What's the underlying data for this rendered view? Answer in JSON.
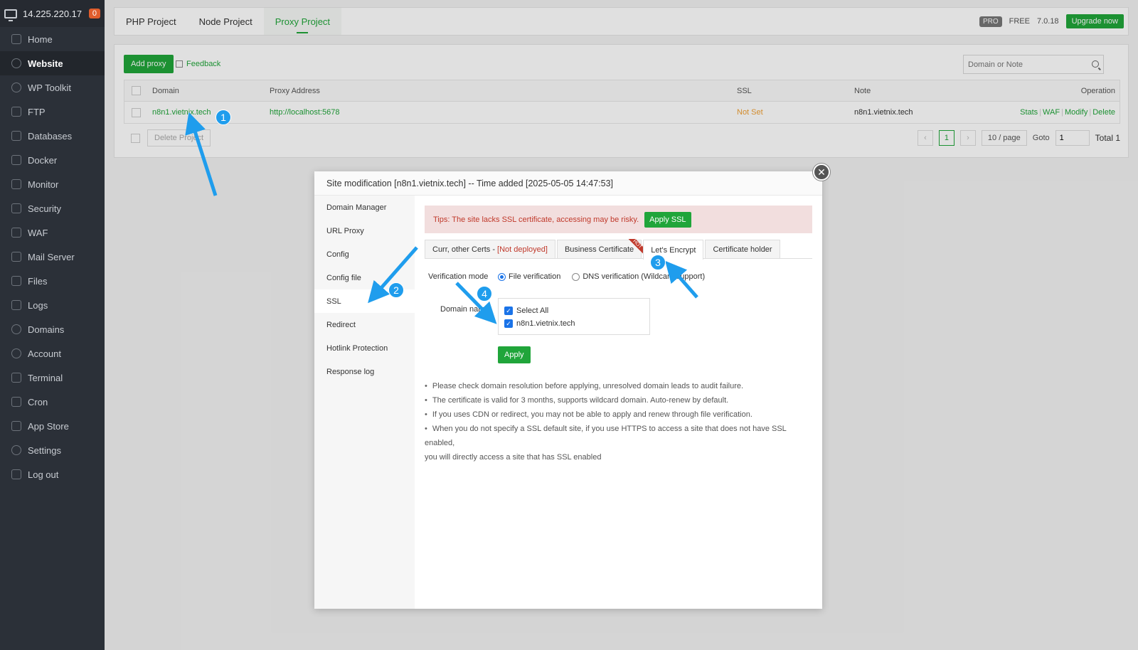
{
  "sidebar": {
    "ip": "14.225.220.17",
    "badge": "0",
    "items": [
      {
        "label": "Home",
        "icon": "home-icon"
      },
      {
        "label": "Website",
        "icon": "globe-icon"
      },
      {
        "label": "WP Toolkit",
        "icon": "wordpress-icon"
      },
      {
        "label": "FTP",
        "icon": "ftp-icon"
      },
      {
        "label": "Databases",
        "icon": "database-icon"
      },
      {
        "label": "Docker",
        "icon": "docker-icon"
      },
      {
        "label": "Monitor",
        "icon": "monitor-icon"
      },
      {
        "label": "Security",
        "icon": "shield-icon"
      },
      {
        "label": "WAF",
        "icon": "waf-icon"
      },
      {
        "label": "Mail Server",
        "icon": "mail-icon"
      },
      {
        "label": "Files",
        "icon": "folder-icon"
      },
      {
        "label": "Logs",
        "icon": "logs-icon"
      },
      {
        "label": "Domains",
        "icon": "domains-icon"
      },
      {
        "label": "Account",
        "icon": "user-icon"
      },
      {
        "label": "Terminal",
        "icon": "terminal-icon"
      },
      {
        "label": "Cron",
        "icon": "cron-icon"
      },
      {
        "label": "App Store",
        "icon": "apps-icon"
      },
      {
        "label": "Settings",
        "icon": "gear-icon"
      },
      {
        "label": "Log out",
        "icon": "logout-icon"
      }
    ]
  },
  "topbar": {
    "tabs": [
      "PHP Project",
      "Node Project",
      "Proxy Project"
    ],
    "pro": "PRO",
    "free": "FREE",
    "version": "7.0.18",
    "upgrade": "Upgrade now"
  },
  "panel": {
    "add_proxy": "Add proxy",
    "feedback": "Feedback",
    "search_placeholder": "Domain or Note",
    "columns": [
      "Domain",
      "Proxy Address",
      "SSL",
      "Note",
      "Operation"
    ],
    "row": {
      "domain": "n8n1.vietnix.tech",
      "proxy": "http://localhost:5678",
      "ssl": "Not Set",
      "note": "n8n1.vietnix.tech",
      "ops": [
        "Stats",
        "WAF",
        "Modify",
        "Delete"
      ]
    },
    "delete_project": "Delete Project",
    "page": "1",
    "page_size": "10 / page",
    "goto": "Goto",
    "goto_value": "1",
    "total": "Total 1"
  },
  "modal": {
    "title": "Site modification [n8n1.vietnix.tech] -- Time added [2025-05-05 14:47:53]",
    "nav": [
      "Domain Manager",
      "URL Proxy",
      "Config",
      "Config file",
      "SSL",
      "Redirect",
      "Hotlink Protection",
      "Response log"
    ],
    "tips": "Tips: The site lacks SSL certificate, accessing may be risky.",
    "apply_ssl": "Apply SSL",
    "ssl_tabs": {
      "curr": "Curr, other Certs - ",
      "curr_status": "[Not deployed]",
      "business": "Business Certificate",
      "hot": "HOT",
      "letsencrypt": "Let's Encrypt",
      "holder": "Certificate holder"
    },
    "verification_label": "Verification mode",
    "file_verification": "File verification",
    "dns_verification": "DNS verification (Wildcard support)",
    "domain_label": "Domain name",
    "select_all": "Select All",
    "domain_item": "n8n1.vietnix.tech",
    "apply": "Apply",
    "notes": [
      "Please check domain resolution before applying, unresolved domain leads to audit failure.",
      "The certificate is valid for 3 months, supports wildcard domain. Auto-renew by default.",
      "If you uses CDN or redirect, you may not be able to apply and renew through file verification.",
      "When you do not specify a SSL default site, if you use HTTPS to access a site that does not have SSL enabled,"
    ],
    "notes_tail": "you will directly access a site that has SSL enabled"
  },
  "annotations": [
    "1",
    "2",
    "3",
    "4"
  ],
  "colors": {
    "accent": "#20a53a",
    "sidebar": "#2b3038",
    "annotation": "#1f9ded"
  }
}
